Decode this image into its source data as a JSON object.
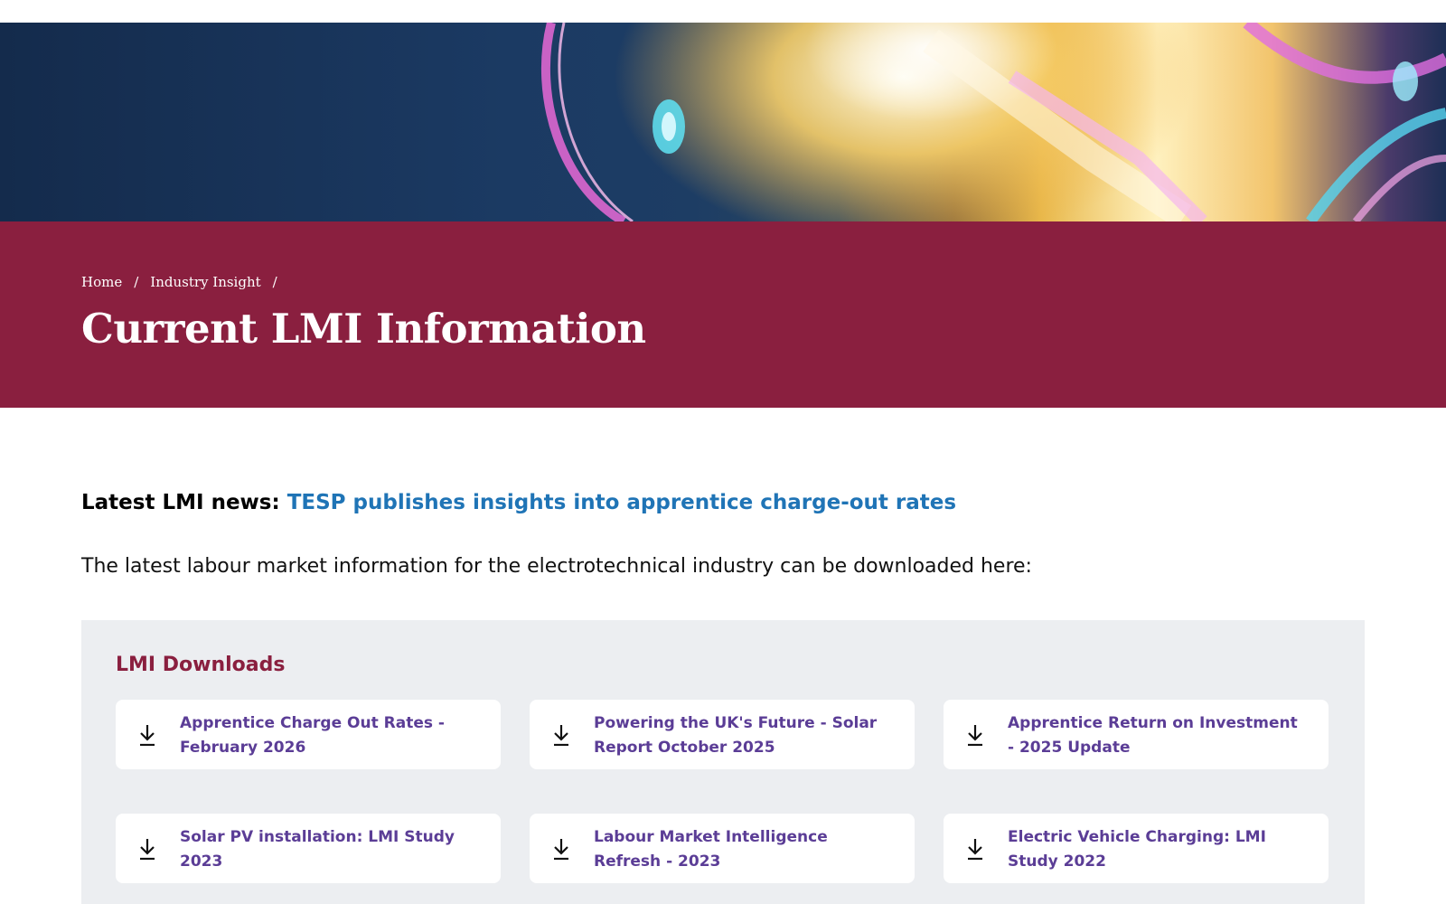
{
  "breadcrumb": {
    "home": "Home",
    "separator": "/",
    "industry_insight": "Industry Insight"
  },
  "page_title": "Current LMI Information",
  "news": {
    "prefix": "Latest LMI news:",
    "link": "TESP publishes insights into apprentice charge-out rates"
  },
  "intro": "The latest labour market information for the electrotechnical industry can be downloaded here:",
  "downloads": {
    "title": "LMI Downloads",
    "icon": "download-icon",
    "items": [
      {
        "label": "Apprentice Charge Out Rates - February 2026"
      },
      {
        "label": "Powering the UK's Future - Solar Report October 2025"
      },
      {
        "label": "Apprentice Return on Investment - 2025 Update"
      },
      {
        "label": "Solar PV installation: LMI Study 2023"
      },
      {
        "label": "Labour Market Intelligence Refresh - 2023"
      },
      {
        "label": "Electric Vehicle Charging: LMI Study 2022"
      }
    ]
  },
  "colors": {
    "title_band": "#8a1f3f",
    "link_blue": "#1f74b6",
    "card_text": "#5b3d96",
    "downloads_bg": "#eceef1"
  }
}
